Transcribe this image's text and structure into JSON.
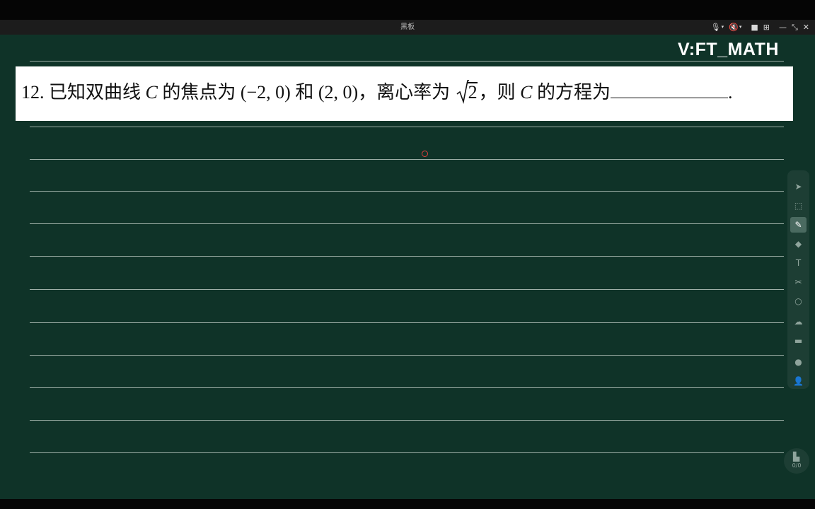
{
  "window": {
    "title": "黑板"
  },
  "watermark": "V:FT_MATH",
  "question": {
    "part1": "12.  已知双曲线 ",
    "var1": "C",
    "part2": " 的焦点为 (−2, 0) 和 (2, 0)，离心率为 ",
    "sqrt_radicand": "2",
    "part3": "，则 ",
    "var2": "C",
    "part4": " 的方程为",
    "end": "."
  },
  "page_indicator": "0/0",
  "colors": {
    "board": "#0f3328",
    "line": "#9fb0a8",
    "pointer": "#e0403c"
  },
  "toolbar_icons": [
    "cursor-icon",
    "box-select-icon",
    "pen-icon",
    "eraser-icon",
    "text-icon",
    "scissors-icon",
    "shape-icon",
    "cloud-icon",
    "briefcase-icon",
    "camera-icon",
    "users-icon"
  ]
}
